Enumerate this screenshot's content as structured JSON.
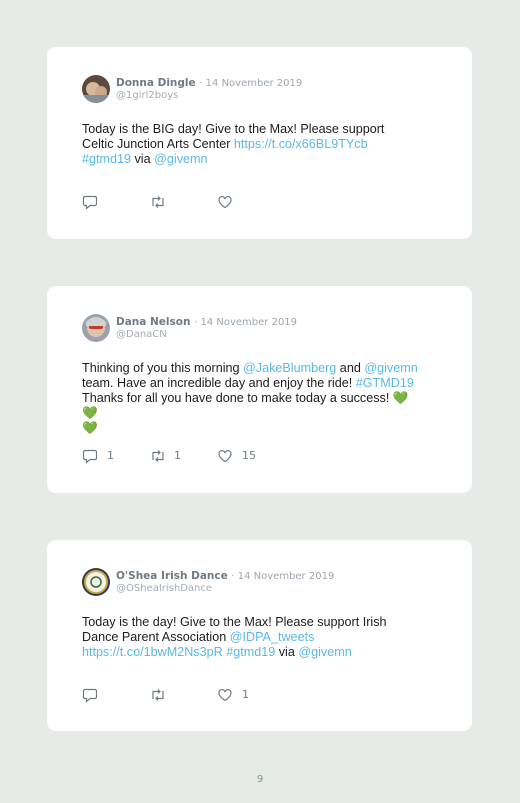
{
  "tweets": [
    {
      "name": "Donna Dingle",
      "date": "· 14 November 2019",
      "handle": "@1girl2boys",
      "text1": "Today is the BIG day! Give to the Max! Please support",
      "text2": "Celtic Junction Arts Center ",
      "link1": "https://t.co/x66BL9TYcb",
      "link2": "#gtmd19",
      "text3": " via ",
      "link3": "@givemn",
      "reply_count": "",
      "retweet_count": "",
      "like_count": ""
    },
    {
      "name": "Dana Nelson",
      "date": "· 14 November 2019",
      "handle": "@DanaCN",
      "text1": "Thinking of you this morning ",
      "link1": "@JakeBlumberg",
      "text2": " and ",
      "link2": "@givemn",
      "text3": "team. Have an incredible day and enjoy the ride! ",
      "link3": "#GTMD19",
      "text4": "Thanks for all you have done to make today a success! ",
      "hearts1": "💚💚",
      "hearts2": "💚",
      "reply_count": "1",
      "retweet_count": "1",
      "like_count": "15"
    },
    {
      "name": "O'Shea Irish Dance",
      "date": "· 14 November 2019",
      "handle": "@OSheaIrishDance",
      "text1": "Today is the day! Give to the Max! Please support Irish",
      "text2": "Dance Parent Association ",
      "link1": "@IDPA_tweets",
      "link2": "https://t.co/1bwM2Ns3pR",
      "text3": " ",
      "link3": "#gtmd19",
      "text4": " via ",
      "link4": "@givemn",
      "reply_count": "",
      "retweet_count": "",
      "like_count": "1"
    }
  ],
  "page_number": "9",
  "colors": {
    "background": "#e6ebe8",
    "link": "#5bb8e6",
    "card": "#ffffff"
  },
  "icons": [
    "reply-icon",
    "retweet-icon",
    "like-icon"
  ]
}
